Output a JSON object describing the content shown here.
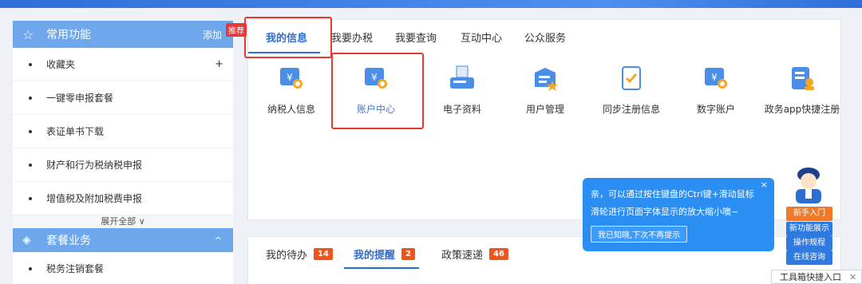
{
  "sidebar": {
    "header_title": "常用功能",
    "add_label": "添加",
    "items": [
      {
        "label": "收藏夹",
        "action": "+"
      },
      {
        "label": "一键零申报套餐"
      },
      {
        "label": "表证单书下载"
      },
      {
        "label": "财产和行为税纳税申报"
      },
      {
        "label": "增值税及附加税费申报"
      }
    ],
    "expand_label": "展开全部 ∨",
    "section2_title": "套餐业务",
    "section2_caret": "^",
    "section2_items": [
      {
        "label": "税务注销套餐"
      }
    ]
  },
  "badge": {
    "label": "推荐"
  },
  "main": {
    "tabs": [
      "我的信息",
      "我要办税",
      "我要查询",
      "互动中心",
      "公众服务"
    ],
    "active_tab": "我的信息",
    "icons": [
      {
        "label": "纳税人信息",
        "icon": "taxpayer-info-icon"
      },
      {
        "label": "账户中心",
        "icon": "account-center-icon"
      },
      {
        "label": "电子资料",
        "icon": "electronic-data-icon"
      },
      {
        "label": "用户管理",
        "icon": "user-management-icon"
      },
      {
        "label": "同步注册信息",
        "icon": "sync-registration-icon"
      },
      {
        "label": "数字账户",
        "icon": "digital-account-icon"
      },
      {
        "label": "政务app快捷注册",
        "icon": "gov-app-register-icon"
      }
    ]
  },
  "lower": {
    "tabs": [
      {
        "label": "我的待办",
        "count": "14"
      },
      {
        "label": "我的提醒",
        "count": "2"
      },
      {
        "label": "政策速递",
        "count": "46"
      }
    ],
    "active_tab": "我的提醒"
  },
  "tooltip": {
    "line1": "亲，可以通过按住键盘的Ctrl键+滑动鼠标",
    "line2": "滑轮进行页面字体显示的放大缩小噢~",
    "ok_label": "我已知晓,下次不再提示",
    "close": "×"
  },
  "assistant": {
    "buttons": [
      "新手入门",
      "新功能展示",
      "操作规程",
      "在线咨询"
    ]
  },
  "toolbox": {
    "label": "工具箱快捷入口",
    "close": "✕"
  },
  "colors": {
    "accent": "#2a6ed8",
    "sidebar_header": "#6fa7ec",
    "highlight": "#e53935",
    "badge": "#f0541c",
    "tooltip": "#2b8ef2"
  }
}
